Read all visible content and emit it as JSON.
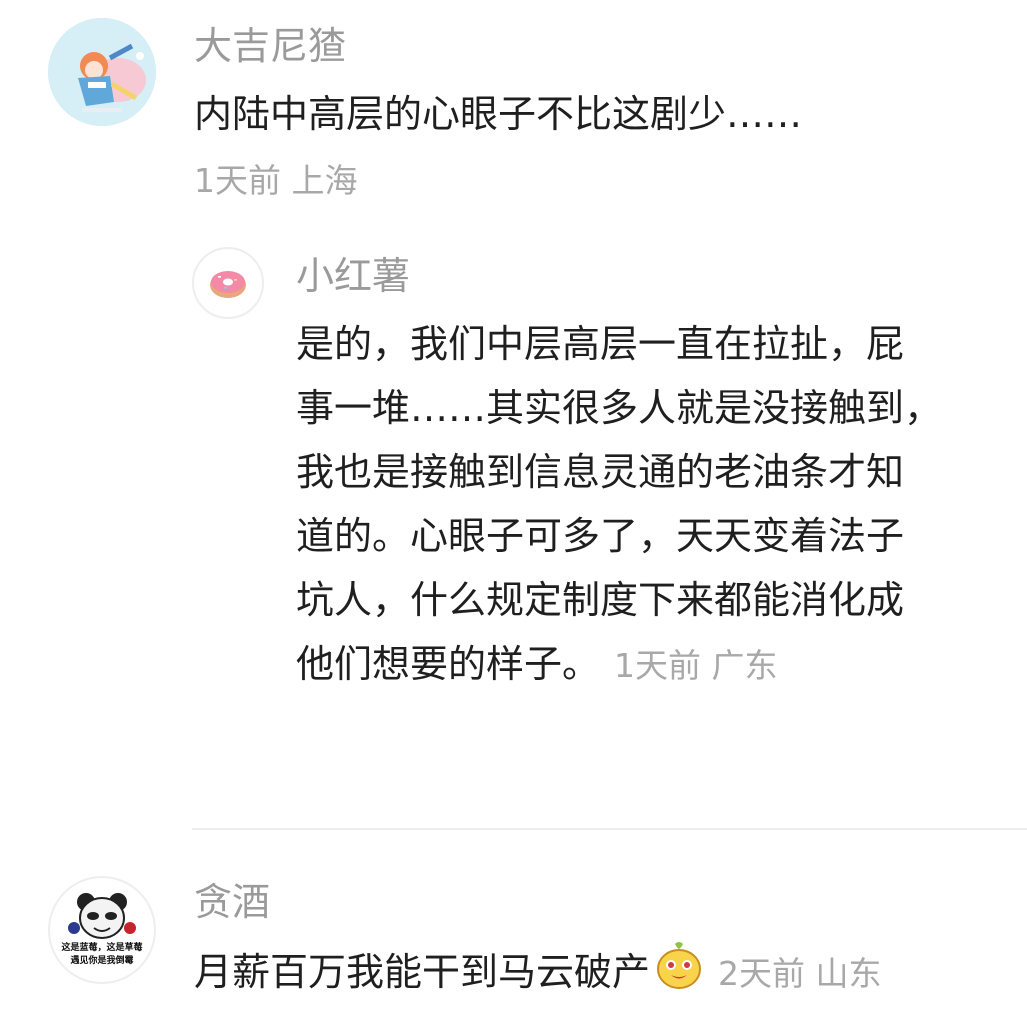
{
  "comments": [
    {
      "username": "大吉尼猹",
      "text": "内陆中高层的心眼子不比这剧少……",
      "time": "1天前",
      "location": "上海",
      "avatar_icon": "anime-girl-avatar-icon",
      "reply": {
        "username": "小红薯",
        "text_lines": [
          "是的，我们中层高层一直在拉扯，屁",
          "事一堆……其实很多人就是没接触到，",
          "我也是接触到信息灵通的老油条才知",
          "道的。心眼子可多了，天天变着法子",
          "坑人，什么规定制度下来都能消化成",
          "他们想要的样子。"
        ],
        "time": "1天前",
        "location": "广东",
        "avatar_icon": "donut-avatar-icon"
      }
    },
    {
      "username": "贪酒",
      "text": "月薪百万我能干到马云破产",
      "time": "2天前",
      "location": "山东",
      "avatar_icon": "panda-meme-avatar-icon",
      "avatar_caption": [
        "这是蓝莓，这是草莓",
        "遇见你是我倒霉"
      ],
      "emoji_icon": "cheeky-emoji-icon"
    }
  ],
  "colors": {
    "name": "#9a9a9a",
    "meta": "#a8a8a8",
    "text": "#1f1f1f"
  }
}
